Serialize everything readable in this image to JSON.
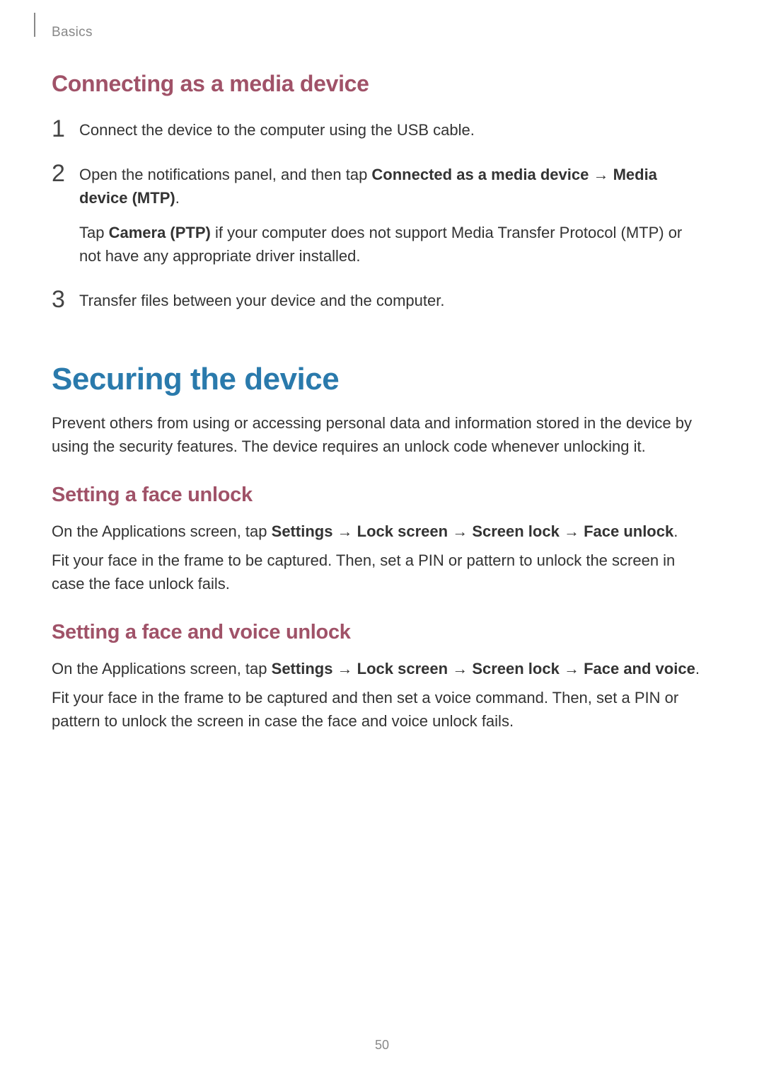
{
  "header": {
    "section": "Basics"
  },
  "sections": {
    "connecting": {
      "title": "Connecting as a media device",
      "step1": {
        "num": "1",
        "text": "Connect the device to the computer using the USB cable."
      },
      "step2": {
        "num": "2",
        "prefix": "Open the notifications panel, and then tap ",
        "bold1": "Connected as a media device",
        "arrow1": " → ",
        "bold2": "Media device (MTP)",
        "suffix": ".",
        "sub_prefix": "Tap ",
        "sub_bold": "Camera (PTP)",
        "sub_suffix": " if your computer does not support Media Transfer Protocol (MTP) or not have any appropriate driver installed."
      },
      "step3": {
        "num": "3",
        "text": "Transfer files between your device and the computer."
      }
    },
    "securing": {
      "title": "Securing the device",
      "intro": "Prevent others from using or accessing personal data and information stored in the device by using the security features. The device requires an unlock code whenever unlocking it.",
      "face_unlock": {
        "title": "Setting a face unlock",
        "p1_prefix": "On the Applications screen, tap ",
        "p1_b1": "Settings",
        "p1_a1": " → ",
        "p1_b2": "Lock screen",
        "p1_a2": " → ",
        "p1_b3": "Screen lock",
        "p1_a3": " → ",
        "p1_b4": "Face unlock",
        "p1_suffix": ".",
        "p2": "Fit your face in the frame to be captured. Then, set a PIN or pattern to unlock the screen in case the face unlock fails."
      },
      "face_voice_unlock": {
        "title": "Setting a face and voice unlock",
        "p1_prefix": "On the Applications screen, tap ",
        "p1_b1": "Settings",
        "p1_a1": " → ",
        "p1_b2": "Lock screen",
        "p1_a2": " → ",
        "p1_b3": "Screen lock",
        "p1_a3": " → ",
        "p1_b4": "Face and voice",
        "p1_suffix": ".",
        "p2": "Fit your face in the frame to be captured and then set a voice command. Then, set a PIN or pattern to unlock the screen in case the face and voice unlock fails."
      }
    }
  },
  "page_number": "50"
}
